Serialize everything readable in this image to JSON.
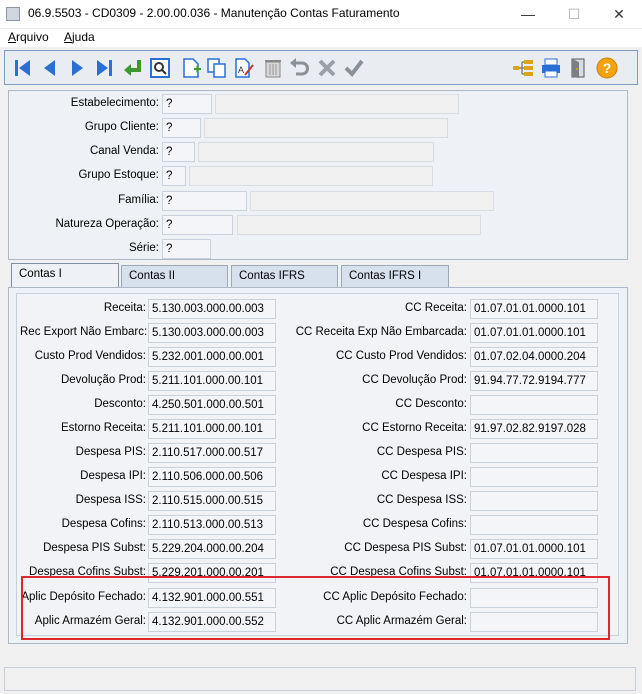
{
  "window": {
    "title": "06.9.5503 - CD0309 - 2.00.00.036 - Manutenção Contas Faturamento",
    "minimize": "—",
    "maximize": "☐",
    "close": "✕"
  },
  "menu": [
    {
      "label": "Arquivo",
      "accel": "A",
      "rest": "rquivo"
    },
    {
      "label": "Ajuda",
      "accel": "A",
      "rest": "juda"
    }
  ],
  "toolbar": {
    "icons": [
      "first-icon",
      "previous-icon",
      "next-icon",
      "last-icon",
      "goto-icon",
      "search-icon",
      "new-icon",
      "copy-icon",
      "edit-icon",
      "delete-icon",
      "undo-icon",
      "cancel-icon",
      "save-icon",
      "tree-icon",
      "print-icon",
      "exit-icon",
      "help-icon"
    ],
    "help_glyph": "?"
  },
  "header": {
    "estabelecimento": {
      "label": "Estabelecimento:",
      "code": "?",
      "desc": ""
    },
    "grupo_cliente": {
      "label": "Grupo Cliente:",
      "code": "?",
      "desc": ""
    },
    "canal_venda": {
      "label": "Canal Venda:",
      "code": "?",
      "desc": ""
    },
    "grupo_estoque": {
      "label": "Grupo Estoque:",
      "code": "?",
      "desc": ""
    },
    "familia": {
      "label": "Família:",
      "code": "?",
      "desc": ""
    },
    "natureza_operacao": {
      "label": "Natureza Operação:",
      "code": "?",
      "desc": ""
    },
    "serie": {
      "label": "Série:",
      "code": "?"
    }
  },
  "tabs": [
    {
      "label": "Contas I",
      "active": true
    },
    {
      "label": "Contas II",
      "active": false
    },
    {
      "label": "Contas IFRS",
      "active": false
    },
    {
      "label": "Contas IFRS I",
      "active": false
    }
  ],
  "accounts": {
    "receita": {
      "label": "Receita:",
      "value": "5.130.003.000.00.003",
      "cc_label": "CC Receita:",
      "cc_value": "01.07.01.01.0000.101"
    },
    "rec_export": {
      "label": "Rec Export Não Embarc:",
      "value": "5.130.003.000.00.003",
      "cc_label": "CC Receita Exp Não Embarcada:",
      "cc_value": "01.07.01.01.0000.101"
    },
    "custo_prod": {
      "label": "Custo Prod Vendidos:",
      "value": "5.232.001.000.00.001",
      "cc_label": "CC Custo Prod Vendidos:",
      "cc_value": "01.07.02.04.0000.204"
    },
    "devolucao": {
      "label": "Devolução Prod:",
      "value": "5.211.101.000.00.101",
      "cc_label": "CC Devolução Prod:",
      "cc_value": "91.94.77.72.9194.777"
    },
    "desconto": {
      "label": "Desconto:",
      "value": "4.250.501.000.00.501",
      "cc_label": "CC Desconto:",
      "cc_value": ""
    },
    "estorno": {
      "label": "Estorno Receita:",
      "value": "5.211.101.000.00.101",
      "cc_label": "CC Estorno Receita:",
      "cc_value": "91.97.02.82.9197.028"
    },
    "desp_pis": {
      "label": "Despesa PIS:",
      "value": "2.110.517.000.00.517",
      "cc_label": "CC Despesa PIS:",
      "cc_value": ""
    },
    "desp_ipi": {
      "label": "Despesa IPI:",
      "value": "2.110.506.000.00.506",
      "cc_label": "CC Despesa IPI:",
      "cc_value": ""
    },
    "desp_iss": {
      "label": "Despesa ISS:",
      "value": "2.110.515.000.00.515",
      "cc_label": "CC Despesa ISS:",
      "cc_value": ""
    },
    "desp_cofins": {
      "label": "Despesa Cofins:",
      "value": "2.110.513.000.00.513",
      "cc_label": "CC Despesa Cofins:",
      "cc_value": ""
    },
    "desp_pis_subst": {
      "label": "Despesa PIS Subst:",
      "value": "5.229.204.000.00.204",
      "cc_label": "CC Despesa PIS Subst:",
      "cc_value": "01.07.01.01.0000.101"
    },
    "desp_cofins_subst": {
      "label": "Despesa Cofins Subst:",
      "value": "5.229.201.000.00.201",
      "cc_label": "CC Despesa Cofins Subst:",
      "cc_value": "01.07.01.01.0000.101"
    },
    "aplic_deposito": {
      "label": "Aplic Depósito Fechado:",
      "value": "4.132.901.000.00.551",
      "cc_label": "CC Aplic Depósito Fechado:",
      "cc_value": ""
    },
    "aplic_armazem": {
      "label": "Aplic Armazém Geral:",
      "value": "4.132.901.000.00.552",
      "cc_label": "CC Aplic Armazém Geral:",
      "cc_value": ""
    }
  },
  "colors": {
    "highlight": "#e0262e",
    "toolbar_blue": "#2a6fd6"
  }
}
